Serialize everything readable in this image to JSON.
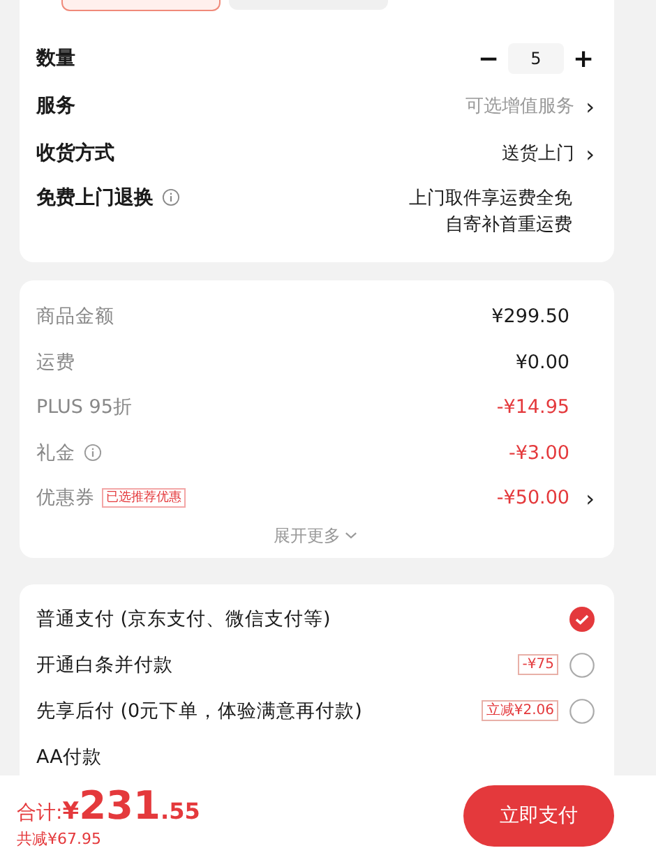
{
  "spec_chips": [
    {
      "selected": true
    },
    {
      "selected": false
    }
  ],
  "order_rows": [
    {
      "kind": "stepper",
      "label": "数量",
      "value": "5",
      "minus": "−",
      "plus": "+"
    },
    {
      "kind": "link",
      "label": "服务",
      "value": "可选增值服务",
      "muted": true,
      "arrow": "›"
    },
    {
      "kind": "link",
      "label": "收货方式",
      "value": "送货上门",
      "muted": false,
      "arrow": "›"
    },
    {
      "kind": "info",
      "label": "免费上门退换",
      "lines": [
        "上门取件享运费全免",
        "自寄补首重运费"
      ]
    }
  ],
  "price_rows": [
    {
      "label": "商品金额",
      "value": "¥299.50",
      "discount": false
    },
    {
      "label": "运费",
      "value": "¥0.00",
      "discount": false
    },
    {
      "label": "PLUS 95折",
      "value": "-¥14.95",
      "discount": true
    },
    {
      "label": "礼金",
      "info": true,
      "value": "-¥3.00",
      "discount": true
    },
    {
      "label": "优惠券",
      "tag": "已选推荐优惠",
      "value": "-¥50.00",
      "discount": true,
      "arrow": "›"
    }
  ],
  "expand": "展开更多",
  "payments": [
    {
      "label": "普通支付 (京东支付、微信支付等)",
      "selected": true
    },
    {
      "label": "开通白条并付款",
      "tag": "-¥75",
      "selected": false
    },
    {
      "label": "先享后付 (0元下单，体验满意再付款)",
      "tag": "立减¥2.06",
      "selected": false
    },
    {
      "label": "AA付款"
    }
  ],
  "footer": {
    "total_label": "合计:",
    "currency": "¥",
    "total_int": "231",
    "total_dec": ".55",
    "saved": "共减¥67.95",
    "pay_button": "立即支付"
  }
}
